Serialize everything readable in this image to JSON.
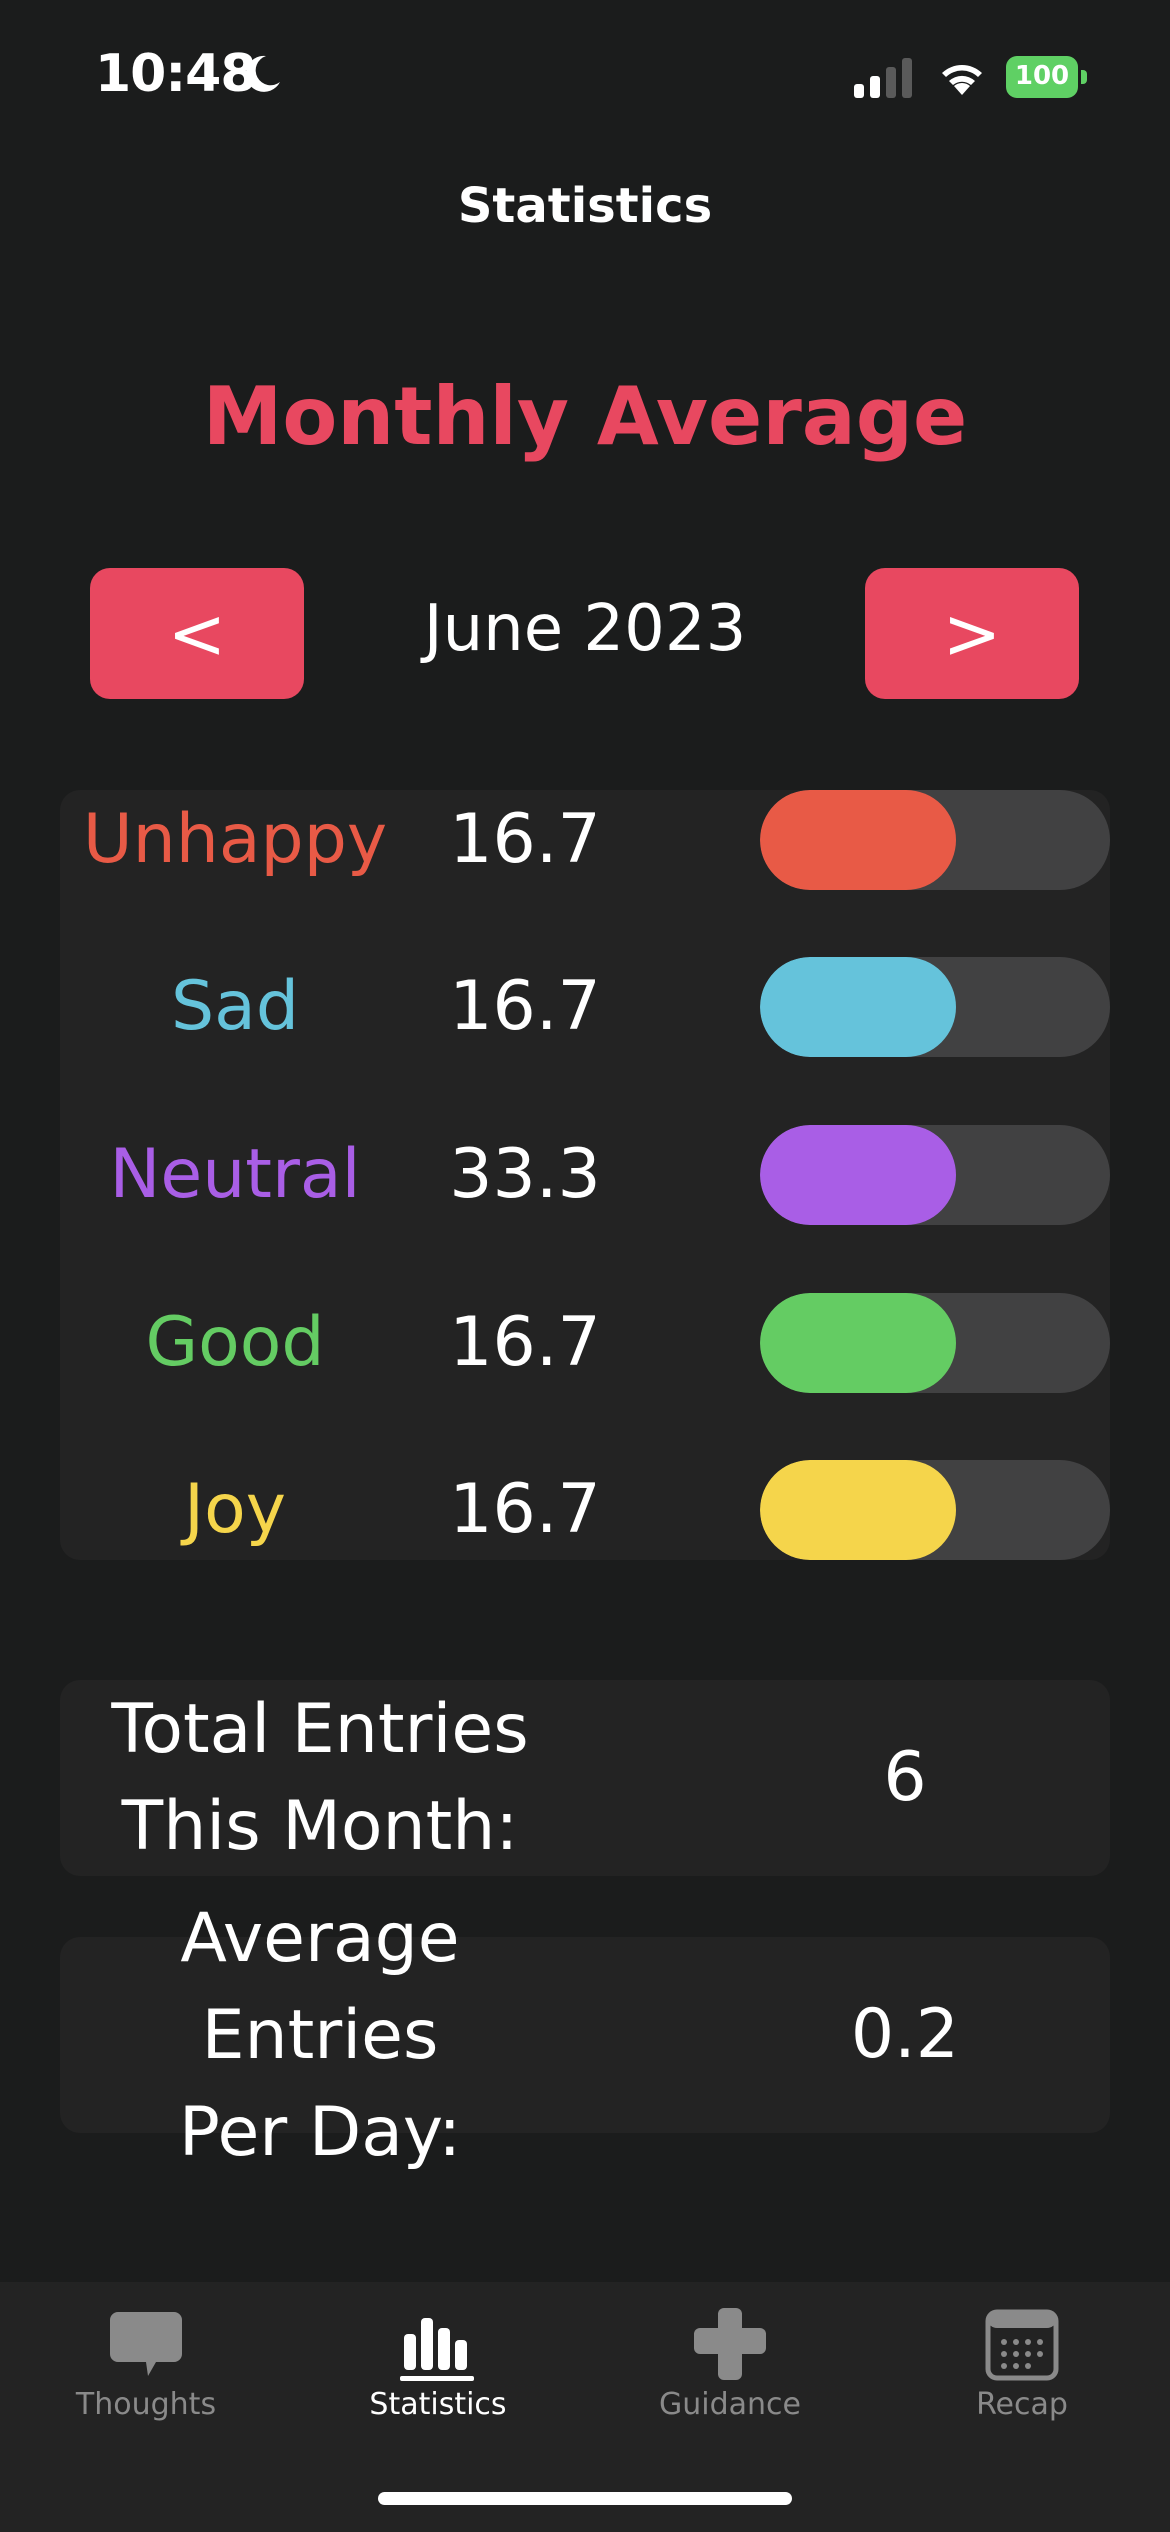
{
  "status_bar": {
    "time": "10:48",
    "battery": "100",
    "icons": [
      "moon-icon",
      "cellular-signal-icon",
      "wifi-icon",
      "battery-charging-icon"
    ]
  },
  "nav": {
    "title": "Statistics"
  },
  "heading": "Monthly Average",
  "month_nav": {
    "prev_label": "<",
    "next_label": ">",
    "month": "June 2023"
  },
  "moods": [
    {
      "name": "Unhappy",
      "value": "16.7",
      "fill_fraction": 0.56,
      "color": "#e85a46"
    },
    {
      "name": "Sad",
      "value": "16.7",
      "fill_fraction": 0.56,
      "color": "#65c3db"
    },
    {
      "name": "Neutral",
      "value": "33.3",
      "fill_fraction": 0.56,
      "color": "#a95ee6"
    },
    {
      "name": "Good",
      "value": "16.7",
      "fill_fraction": 0.56,
      "color": "#64cc63"
    },
    {
      "name": "Joy",
      "value": "16.7",
      "fill_fraction": 0.56,
      "color": "#f5d54b"
    }
  ],
  "summary": {
    "total_label": "Total Entries\nThis Month:",
    "total_value": "6",
    "avg_label": "Average Entries\nPer Day:",
    "avg_value": "0.2"
  },
  "tabs": [
    {
      "label": "Thoughts",
      "icon": "speech-bubble-icon",
      "active": false
    },
    {
      "label": "Statistics",
      "icon": "bar-chart-icon",
      "active": true
    },
    {
      "label": "Guidance",
      "icon": "plus-cross-icon",
      "active": false
    },
    {
      "label": "Recap",
      "icon": "calendar-icon",
      "active": false
    }
  ],
  "colors": {
    "accent": "#e84860",
    "background": "#1b1c1c",
    "panel": "#232323",
    "track": "#414142"
  }
}
